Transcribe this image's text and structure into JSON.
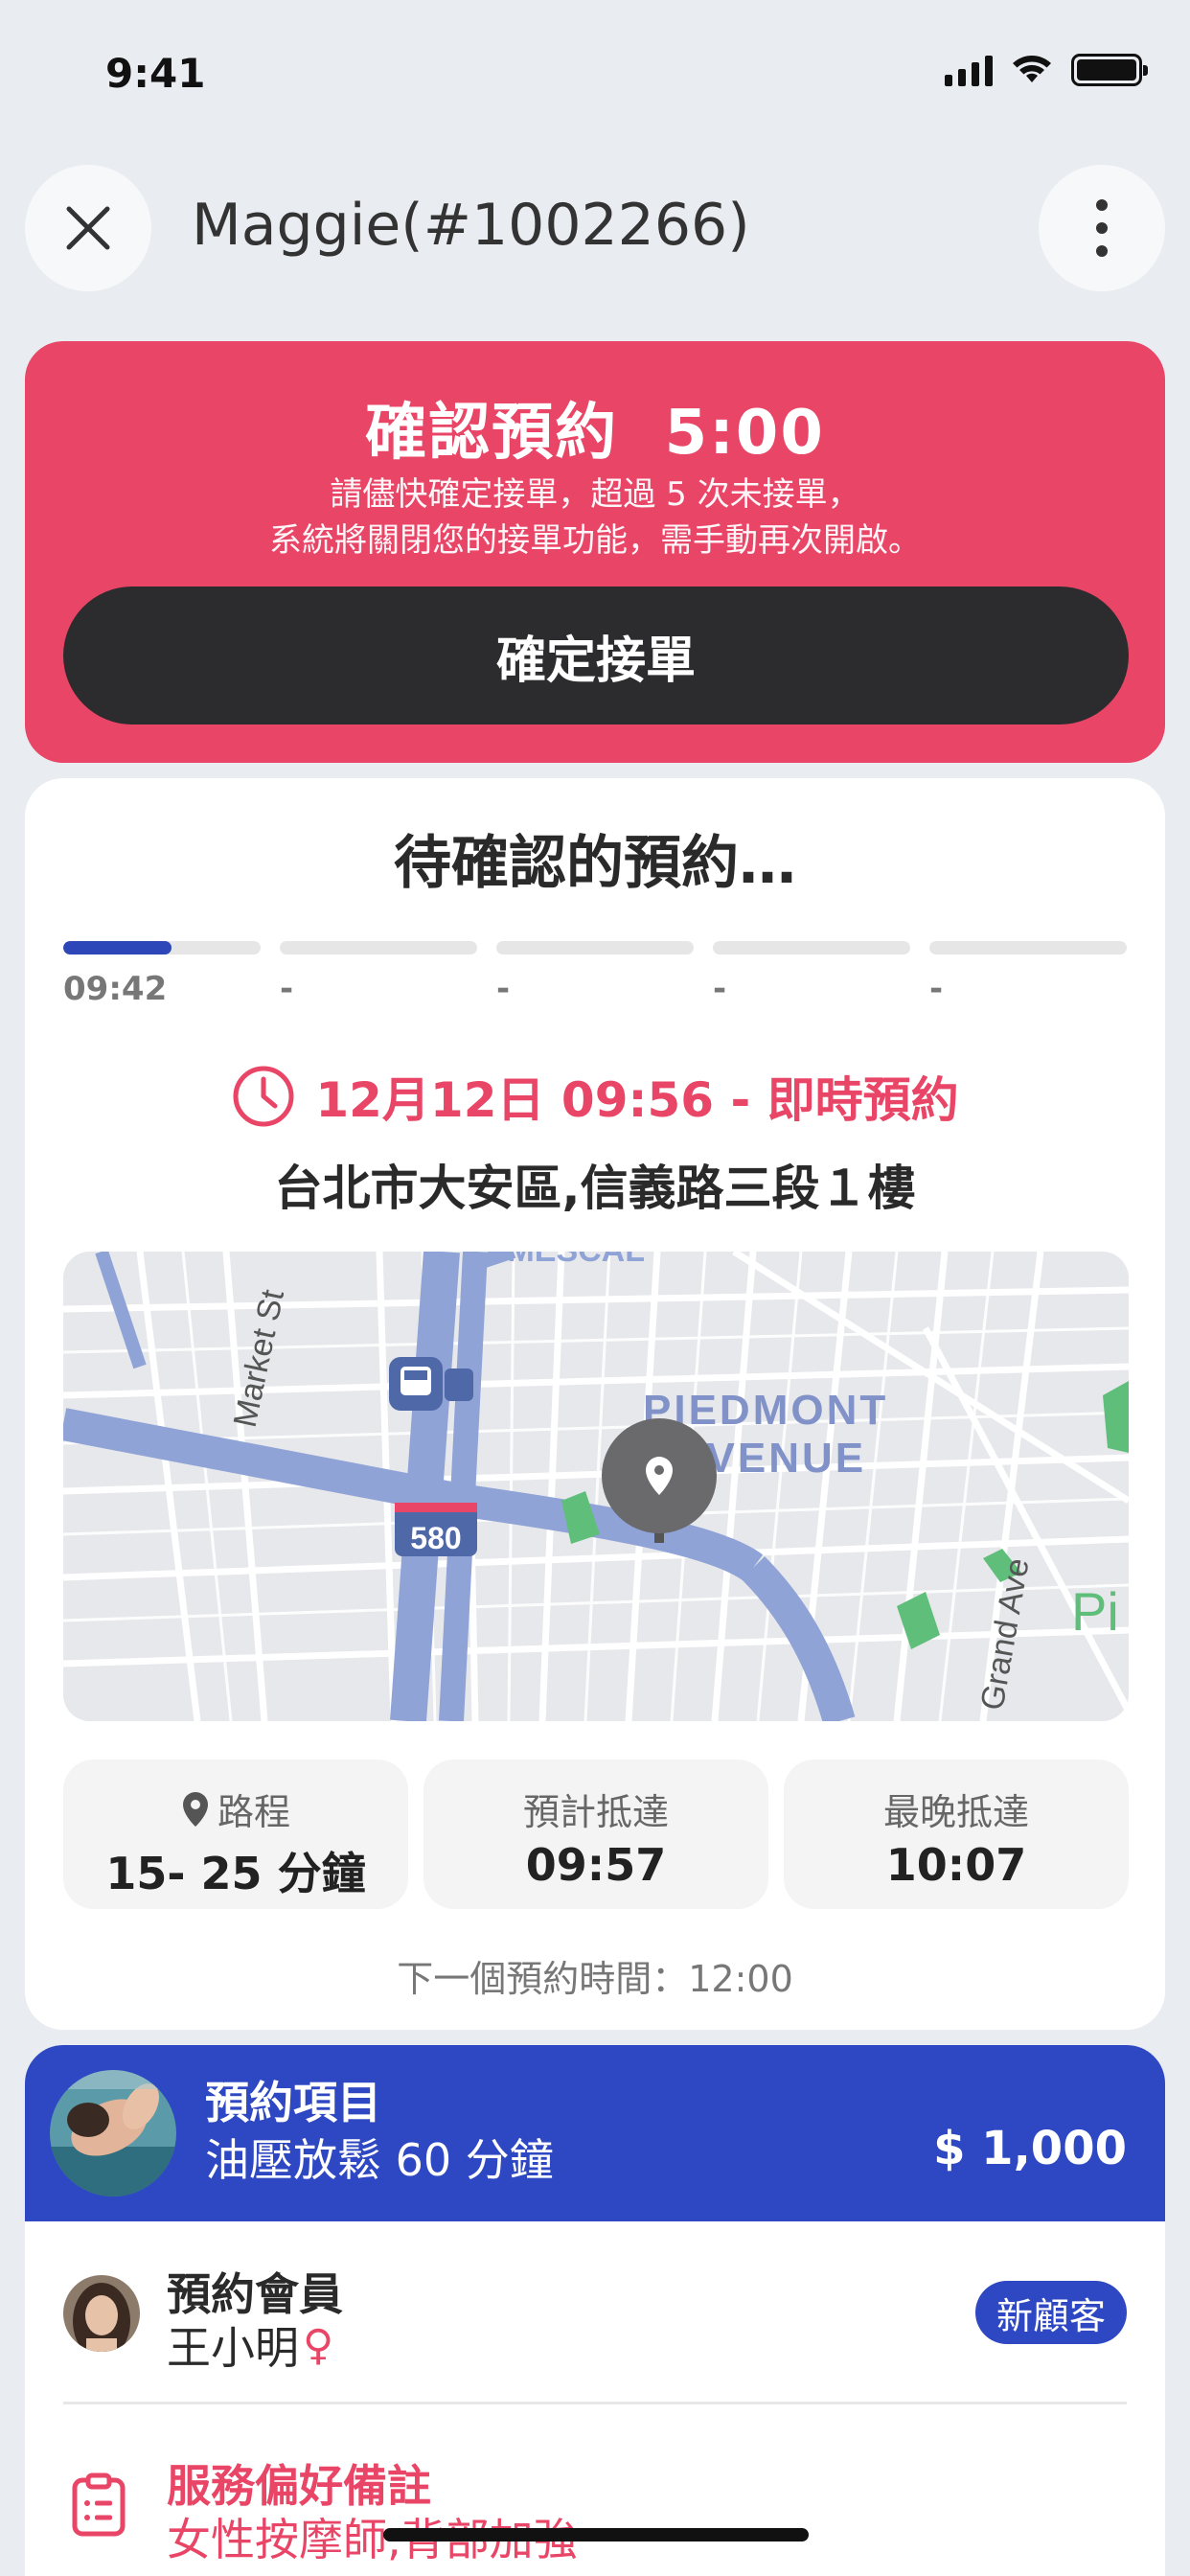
{
  "status_bar": {
    "time": "9:41"
  },
  "header": {
    "title": "Maggie(#1002266)"
  },
  "confirm": {
    "title": "確認預約  5:00",
    "message_line1": "請儘快確定接單，超過 5 次未接單，",
    "message_line2": "系統將關閉您的接單功能，需手動再次開啟。",
    "button": "確定接單"
  },
  "pending": {
    "title": "待確認的預約…",
    "progress": [
      {
        "label": "09:42",
        "fraction": 0.55
      },
      {
        "label": "-",
        "fraction": 0
      },
      {
        "label": "-",
        "fraction": 0
      },
      {
        "label": "-",
        "fraction": 0
      },
      {
        "label": "-",
        "fraction": 0
      }
    ],
    "appointment_time": "12月12日 09:56 - 即時預約",
    "address": "台北市大安區,信義路三段１樓",
    "map": {
      "labels": {
        "market_st": "Market St",
        "piedmont_line1": "PIEDMONT",
        "piedmont_line2": "AVENUE",
        "grand_ave": "Grand Ave",
        "highway": "580",
        "pi": "Pi",
        "top_fragment": "TEMESCAL"
      }
    },
    "stats": [
      {
        "label": "路程",
        "value": "15- 25 分鐘"
      },
      {
        "label": "預計抵達",
        "value": "09:57"
      },
      {
        "label": "最晚抵達",
        "value": "10:07"
      }
    ],
    "next_appointment": "下一個預約時間：12:00"
  },
  "service": {
    "title": "預約項目",
    "name": "油壓放鬆 60 分鐘",
    "price": "$ 1,000"
  },
  "member": {
    "title": "預約會員",
    "name": "王小明",
    "gender_symbol": "♀",
    "badge": "新顧客"
  },
  "preference": {
    "title": "服務偏好備註",
    "note": "女性按摩師,背部加強"
  },
  "colors": {
    "accent_red": "#E94566",
    "primary_blue": "#2E47C2",
    "dark_button": "#2C2C2E"
  }
}
